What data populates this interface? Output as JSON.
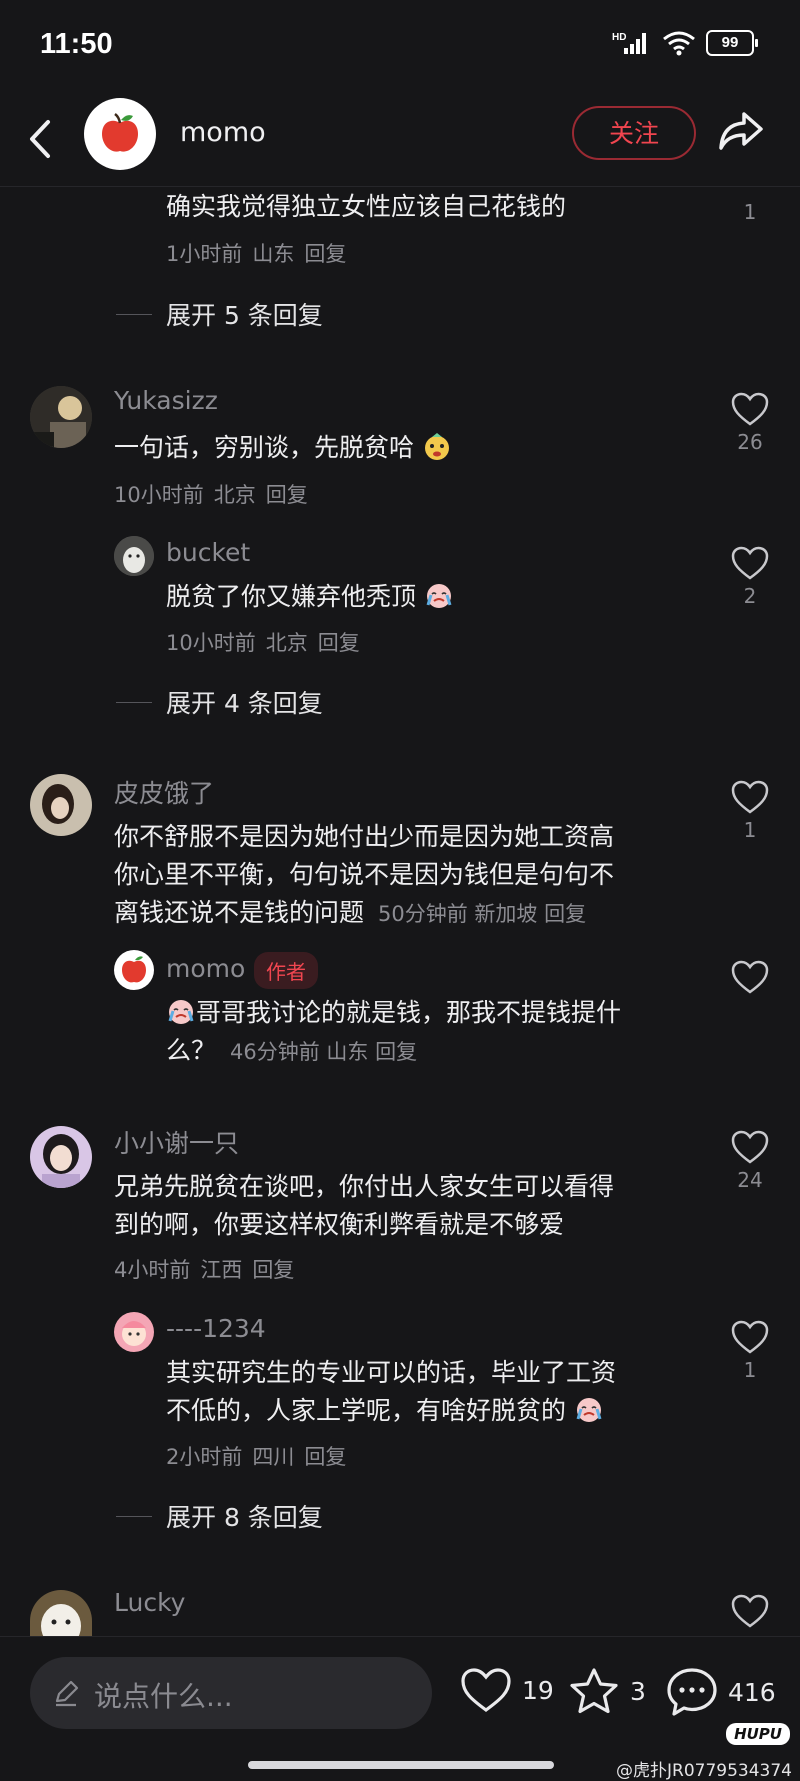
{
  "status": {
    "time": "11:50",
    "net": "HD",
    "battery": "99"
  },
  "header": {
    "title": "momo",
    "follow_label": "关注"
  },
  "comments": [
    {
      "text": "确实我觉得独立女性应该自己花钱的",
      "time": "1小时前",
      "loc": "山东",
      "reply": "回复",
      "likes": "1"
    },
    {
      "expand": "展开 5 条回复"
    },
    {
      "name": "Yukasizz",
      "text": "一句话，穷别谈，先脱贫哈",
      "time": "10小时前",
      "loc": "北京",
      "reply": "回复",
      "likes": "26"
    },
    {
      "name": "bucket",
      "text": "脱贫了你又嫌弃他秃顶",
      "time": "10小时前",
      "loc": "北京",
      "reply": "回复",
      "likes": "2"
    },
    {
      "expand": "展开 4 条回复"
    },
    {
      "name": "皮皮饿了",
      "line1": "你不舒服不是因为她付出少而是因为她工资高",
      "line2": "你心里不平衡，句句说不是因为钱但是句句不",
      "line3": "离钱还说不是钱的问题",
      "time": "50分钟前",
      "loc": "新加坡",
      "reply": "回复",
      "likes": "1"
    },
    {
      "name": "momo",
      "tag": "作者",
      "line1": "哥哥我讨论的就是钱，那我不提钱提什",
      "line2": "么？",
      "time": "46分钟前",
      "loc": "山东",
      "reply": "回复"
    },
    {
      "name": "小小谢一只",
      "line1": "兄弟先脱贫在谈吧，你付出人家女生可以看得",
      "line2": "到的啊，你要这样权衡利弊看就是不够爱",
      "time": "4小时前",
      "loc": "江西",
      "reply": "回复",
      "likes": "24"
    },
    {
      "name": "----1234",
      "line1": "其实研究生的专业可以的话，毕业了工资",
      "line2": "不低的，人家上学呢，有啥好脱贫的",
      "time": "2小时前",
      "loc": "四川",
      "reply": "回复",
      "likes": "1"
    },
    {
      "expand": "展开 8 条回复"
    },
    {
      "name": "Lucky"
    }
  ],
  "bottom": {
    "placeholder": "说点什么...",
    "likes": "19",
    "stars": "3",
    "comments": "416",
    "brand": "HUPU"
  },
  "watermark": "@虎扑JR0779534374"
}
